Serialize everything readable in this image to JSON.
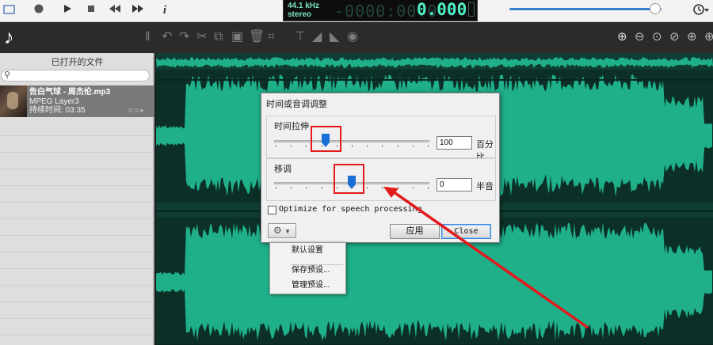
{
  "transport": {
    "record_icon": "record-icon",
    "play_icon": "play-icon",
    "stop_icon": "stop-icon",
    "rewind_icon": "rewind-icon",
    "forward_icon": "fast-forward-icon",
    "info_label": "i"
  },
  "display": {
    "sample_rate": "44.1 kHz",
    "channels": "stereo",
    "ghost_digits": "-0000:00.0",
    "time": "0.000"
  },
  "volume": {
    "level": 0.96
  },
  "sidebar": {
    "title": "已打开的文件",
    "search_placeholder": "",
    "files": [
      {
        "name": "告白气球 - 周杰伦.mp3",
        "format": "MPEG Layer3",
        "duration": "持续时间: 03:35"
      }
    ]
  },
  "dialog": {
    "title": "时间或音调调整",
    "stretch": {
      "label": "时间拉伸",
      "value": "100",
      "unit": "百分比"
    },
    "pitch": {
      "label": "移调",
      "value": "0",
      "unit": "半音"
    },
    "optimize_label": "Optimize for speech processing",
    "optimize_checked": false,
    "apply_label": "应用",
    "close_label": "Close"
  },
  "preset_menu": {
    "items": [
      "默认设置",
      "保存预设...",
      "管理预设..."
    ]
  },
  "colors": {
    "waveform": "#1fb08a",
    "annotation": "#e3191c",
    "accent": "#1a6fd6"
  }
}
